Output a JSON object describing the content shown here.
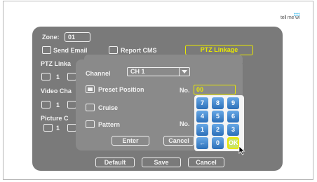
{
  "brand": {
    "logo": "tell me wi"
  },
  "form": {
    "zone_label": "Zone:",
    "zone_value": "01",
    "send_email": "Send Email",
    "report_cms": "Report CMS",
    "ptz_linkage_button": "PTZ Linkage",
    "ptz_linkage_label": "PTZ Linka",
    "video_label": "Video Cha",
    "picture_label": "Picture C",
    "partial_1": "1",
    "default_button": "Default",
    "save_button": "Save",
    "cancel_button": "Cancel"
  },
  "dialog": {
    "channel_label": "Channel",
    "channel_value": "CH 1",
    "preset_label": "Preset Position",
    "cruise_label": "Cruise",
    "pattern_label": "Pattern",
    "no_label": "No.",
    "no_label_2": "No.",
    "no_value": "00",
    "enter_button": "Enter",
    "cancel_button": "Cancel"
  },
  "keypad": {
    "keys": [
      "7",
      "8",
      "9",
      "4",
      "5",
      "6",
      "1",
      "2",
      "3",
      "←",
      "0",
      "OK"
    ]
  },
  "colors": {
    "panel": "#7a7a7a",
    "dialog": "#8a8a8a",
    "accent": "#e8e800",
    "key": "#2c6fb8"
  }
}
